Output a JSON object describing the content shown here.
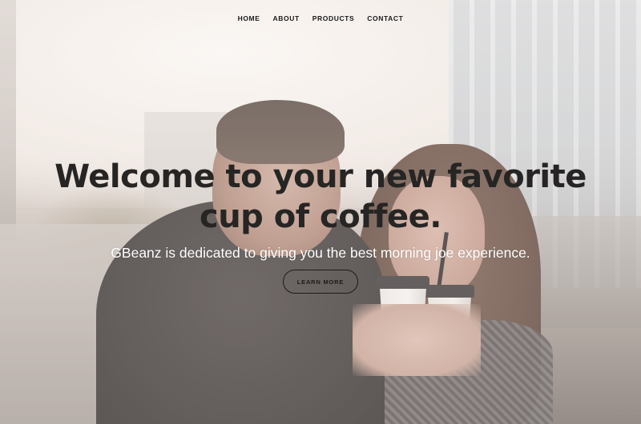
{
  "nav": {
    "items": [
      {
        "label": "HOME"
      },
      {
        "label": "ABOUT"
      },
      {
        "label": "PRODUCTS"
      },
      {
        "label": "CONTACT"
      }
    ]
  },
  "hero": {
    "title_line1": "Welcome to your new favorite",
    "title_line2": "cup of coffee.",
    "subtitle": "GBeanz is dedicated to giving you the best morning joe experience.",
    "cta_label": "LEARN MORE",
    "background_image": "couple-holding-coffee-cups-photo"
  },
  "colors": {
    "title": "#262524",
    "subtitle": "#ffffff",
    "nav_text": "#1a1a1a",
    "button_border": "#1d1b1b",
    "overlay": "rgba(250,244,240,0.28)"
  }
}
